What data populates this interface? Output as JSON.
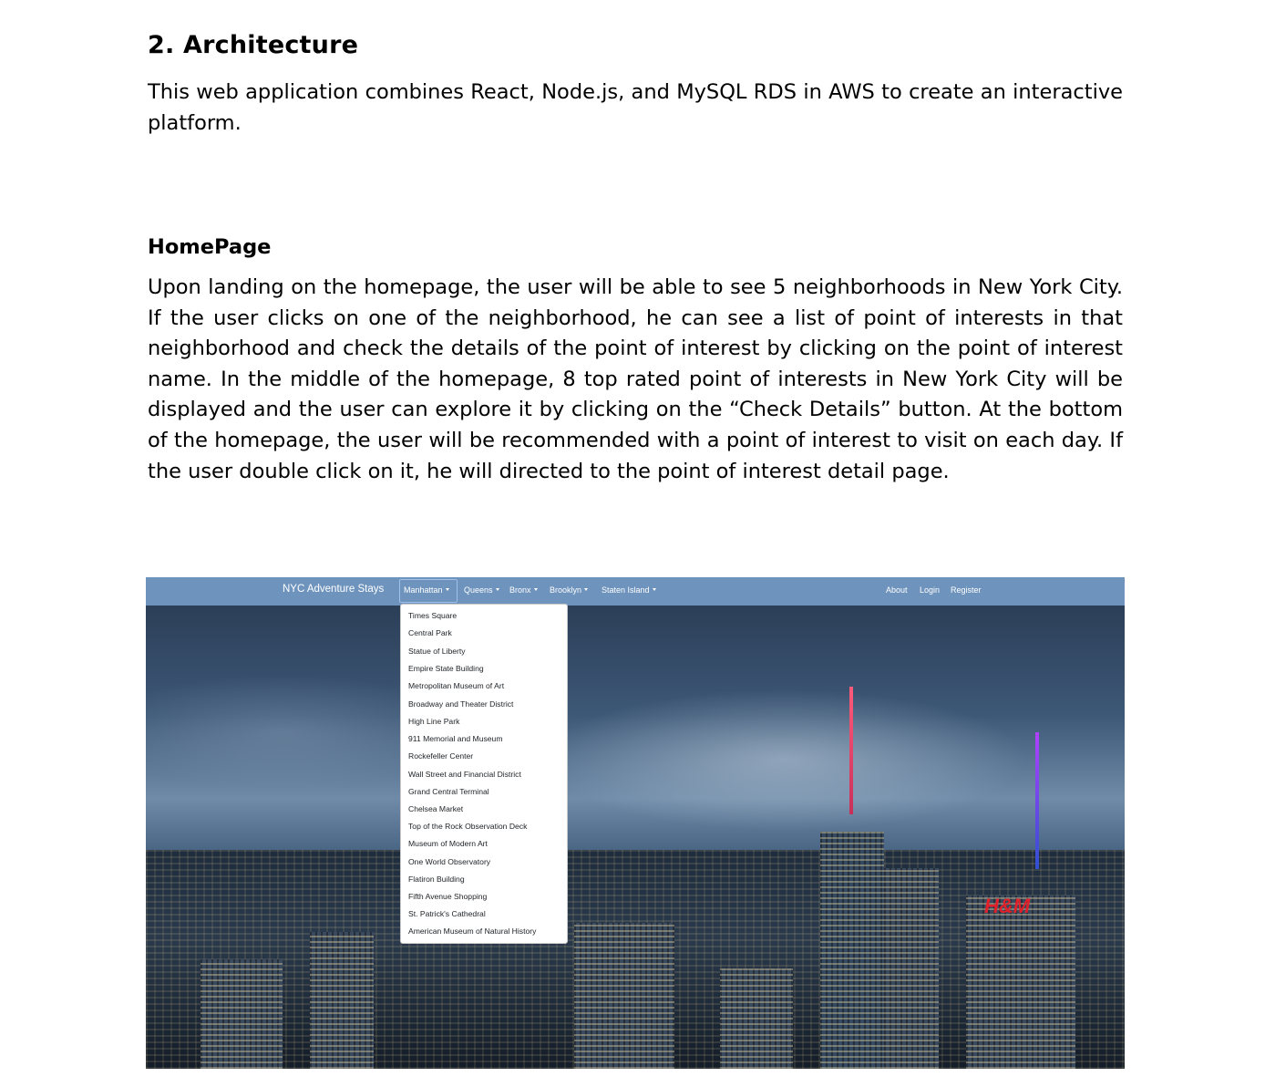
{
  "section": {
    "heading": "2. Architecture",
    "intro": "This web application combines React, Node.js, and MySQL RDS in AWS to create an interactive platform."
  },
  "homepage": {
    "heading": "HomePage",
    "description": "Upon landing on the homepage, the user will be able to see 5 neighborhoods in New York City. If the user clicks on one of the neighborhood, he can see a list of point of interests in that neighborhood and check the details of the point of interest by clicking on the point of interest name. In the middle of the homepage, 8 top rated point of interests in New York City will be displayed and the user can explore it by clicking on the “Check Details” button. At the bottom of the homepage, the user will be recommended with a point of interest to visit on each day. If the user double click on it, he will directed to the point of interest detail page."
  },
  "screenshot": {
    "navbar": {
      "brand": "NYC Adventure Stays",
      "color": "#6e93bd",
      "menus": [
        "Manhattan",
        "Queens",
        "Bronx",
        "Brooklyn",
        "Staten Island"
      ],
      "right_links": [
        "About",
        "Login",
        "Register"
      ]
    },
    "dropdown_items": [
      "Times Square",
      "Central Park",
      "Statue of Liberty",
      "Empire State Building",
      "Metropolitan Museum of Art",
      "Broadway and Theater District",
      "High Line Park",
      "911 Memorial and Museum",
      "Rockefeller Center",
      "Wall Street and Financial District",
      "Grand Central Terminal",
      "Chelsea Market",
      "Top of the Rock Observation Deck",
      "Museum of Modern Art",
      "One World Observatory",
      "Flatiron Building",
      "Fifth Avenue Shopping",
      "St. Patrick's Cathedral",
      "American Museum of Natural History"
    ],
    "sign_text": "H&M"
  }
}
